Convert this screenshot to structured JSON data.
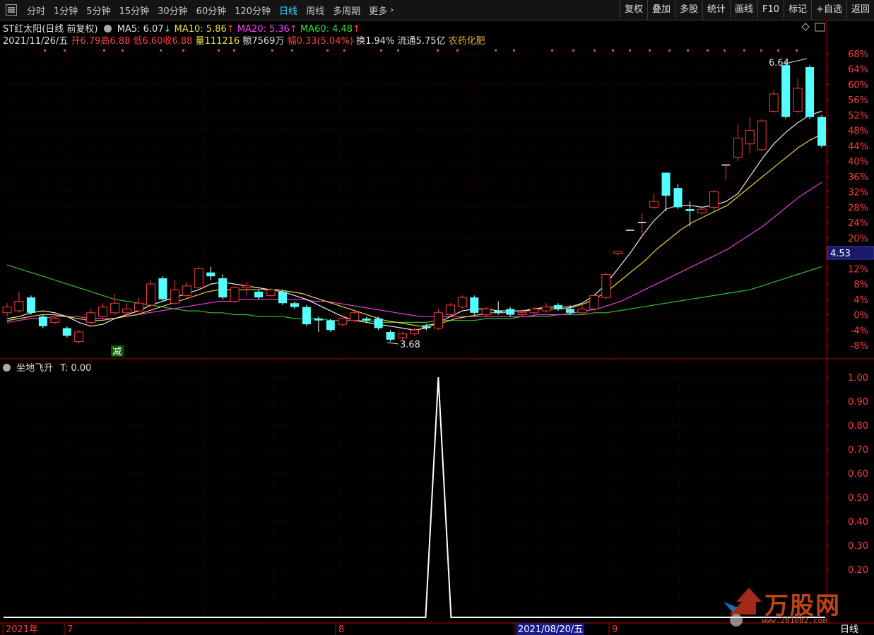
{
  "toolbar": {
    "tabs": [
      "分时",
      "1分钟",
      "5分钟",
      "15分钟",
      "30分钟",
      "60分钟",
      "120分钟",
      "日线",
      "周线",
      "多周期",
      "更多"
    ],
    "active_tab": "日线",
    "right_buttons": [
      "复权",
      "叠加",
      "多股",
      "统计",
      "画线",
      "F10",
      "标记",
      "+自选",
      "返回"
    ]
  },
  "stock": {
    "name": "ST红太阳(日线 前复权)",
    "ma5": "MA5: 6.07",
    "ma10": "MA10: 5.86",
    "ma20": "MA20: 5.36",
    "ma60": "MA60: 4.48",
    "date": "2021/11/26/五",
    "open": "开6.79",
    "high": "高6.88",
    "low": "低6.60",
    "close": "收6.88",
    "volume": "量111216",
    "amount": "额7569万",
    "change": "幅0.33(5.04%)",
    "turnover": "换1.94%",
    "float": "流通5.75亿",
    "sector": "农药化肥"
  },
  "price_axis": [
    "68%",
    "64%",
    "60%",
    "56%",
    "52%",
    "48%",
    "44%",
    "40%",
    "36%",
    "32%",
    "28%",
    "24%",
    "20%",
    "16%",
    "12%",
    "8%",
    "4%",
    "0%",
    "-4%",
    "-8%"
  ],
  "current_price_tag": "4.53",
  "annotations": {
    "high_label": "6.64",
    "low_label": "3.68",
    "marker_label": "减"
  },
  "sub_panel": {
    "title": "坐地飞升",
    "value": "T: 0.00",
    "axis": [
      "1.00",
      "0.90",
      "0.80",
      "0.70",
      "0.60",
      "0.50",
      "0.40",
      "0.30",
      "0.20"
    ]
  },
  "time_axis": {
    "labels": [
      "2021年",
      "7",
      "8",
      "2021/08/20/五",
      "9"
    ],
    "bottom_right": "日线"
  },
  "watermark": {
    "brand": "万股网",
    "url": "www.201082.com"
  },
  "colors": {
    "up": "#ff3c3c",
    "down": "#54ffff",
    "ma5": "#e8e8e8",
    "ma10": "#e8d040",
    "ma20": "#e040e0",
    "ma60": "#30c030",
    "grid": "#5a0000"
  },
  "chart_data": {
    "type": "candlestick",
    "candles": [
      {
        "o": 0.5,
        "c": 2.0,
        "h": 3.0,
        "l": -0.5
      },
      {
        "o": 1.0,
        "c": 3.5,
        "h": 6.0,
        "l": 0.5
      },
      {
        "o": 4.5,
        "c": 0.5,
        "h": 5.0,
        "l": 0.0
      },
      {
        "o": -0.5,
        "c": -3.0,
        "h": 0.0,
        "l": -3.5
      },
      {
        "o": -2.0,
        "c": -1.0,
        "h": -0.5,
        "l": -2.5
      },
      {
        "o": -3.5,
        "c": -5.5,
        "h": -3.0,
        "l": -6.0
      },
      {
        "o": -7.0,
        "c": -4.5,
        "h": -4.0,
        "l": -7.5
      },
      {
        "o": -2.0,
        "c": 0.5,
        "h": 1.5,
        "l": -2.5
      },
      {
        "o": -0.5,
        "c": 2.0,
        "h": 3.0,
        "l": -1.0
      },
      {
        "o": 0.5,
        "c": 3.0,
        "h": 5.5,
        "l": 0.0
      },
      {
        "o": 0.5,
        "c": 1.5,
        "h": 3.0,
        "l": -0.5
      },
      {
        "o": 1.0,
        "c": 3.0,
        "h": 4.5,
        "l": 0.5
      },
      {
        "o": 2.5,
        "c": 8.0,
        "h": 9.0,
        "l": 2.0
      },
      {
        "o": 9.5,
        "c": 4.0,
        "h": 10.0,
        "l": 3.5
      },
      {
        "o": 3.0,
        "c": 6.5,
        "h": 9.0,
        "l": 2.5
      },
      {
        "o": 5.0,
        "c": 7.5,
        "h": 8.5,
        "l": 4.5
      },
      {
        "o": 7.0,
        "c": 12.0,
        "h": 12.5,
        "l": 6.5
      },
      {
        "o": 11.0,
        "c": 10.0,
        "h": 12.5,
        "l": 9.0
      },
      {
        "o": 9.5,
        "c": 4.5,
        "h": 10.5,
        "l": 4.0
      },
      {
        "o": 3.5,
        "c": 7.0,
        "h": 7.5,
        "l": 3.0
      },
      {
        "o": 7.0,
        "c": 7.5,
        "h": 8.5,
        "l": 5.0
      },
      {
        "o": 6.0,
        "c": 4.5,
        "h": 6.5,
        "l": 4.0
      },
      {
        "o": 5.0,
        "c": 6.5,
        "h": 7.0,
        "l": 4.5
      },
      {
        "o": 6.0,
        "c": 3.0,
        "h": 6.5,
        "l": 2.5
      },
      {
        "o": 3.0,
        "c": 2.0,
        "h": 3.5,
        "l": 1.5
      },
      {
        "o": 2.0,
        "c": -2.5,
        "h": 2.5,
        "l": -3.0
      },
      {
        "o": -1.0,
        "c": -1.5,
        "h": -0.5,
        "l": -4.5
      },
      {
        "o": -1.5,
        "c": -4.0,
        "h": -1.0,
        "l": -4.5
      },
      {
        "o": -2.5,
        "c": -1.0,
        "h": 0.0,
        "l": -3.0
      },
      {
        "o": -1.5,
        "c": 0.5,
        "h": 1.0,
        "l": -2.0
      },
      {
        "o": -1.0,
        "c": -1.5,
        "h": -0.5,
        "l": -2.0
      },
      {
        "o": -1.0,
        "c": -3.5,
        "h": -0.5,
        "l": -4.0
      },
      {
        "o": -4.5,
        "c": -6.5,
        "h": -4.0,
        "l": -7.0
      },
      {
        "o": -6.0,
        "c": -5.0,
        "h": -4.5,
        "l": -6.5
      },
      {
        "o": -5.0,
        "c": -4.0,
        "h": -3.5,
        "l": -5.5
      },
      {
        "o": -3.0,
        "c": -3.5,
        "h": -2.5,
        "l": -4.0
      },
      {
        "o": -3.5,
        "c": 0.5,
        "h": 1.5,
        "l": -4.0
      },
      {
        "o": 0.0,
        "c": 2.5,
        "h": 3.0,
        "l": -0.5
      },
      {
        "o": 2.0,
        "c": 4.5,
        "h": 5.0,
        "l": 1.5
      },
      {
        "o": 4.5,
        "c": 0.5,
        "h": 5.0,
        "l": 0.0
      },
      {
        "o": 0.0,
        "c": 1.5,
        "h": 2.0,
        "l": -0.5
      },
      {
        "o": 1.0,
        "c": 0.5,
        "h": 3.5,
        "l": 0.0
      },
      {
        "o": 1.5,
        "c": 0.0,
        "h": 2.0,
        "l": -0.5
      },
      {
        "o": 0.0,
        "c": 0.5,
        "h": 1.5,
        "l": -0.5
      },
      {
        "o": 0.5,
        "c": 1.5,
        "h": 2.0,
        "l": 0.0
      },
      {
        "o": 1.0,
        "c": 2.0,
        "h": 3.0,
        "l": 0.5
      },
      {
        "o": 2.5,
        "c": 1.5,
        "h": 3.0,
        "l": 1.0
      },
      {
        "o": 1.5,
        "c": 0.5,
        "h": 2.5,
        "l": 0.0
      },
      {
        "o": 0.5,
        "c": 1.5,
        "h": 2.5,
        "l": 0.0
      },
      {
        "o": 1.5,
        "c": 5.0,
        "h": 5.5,
        "l": 1.0
      },
      {
        "o": 4.5,
        "c": 10.5,
        "h": 11.0,
        "l": 4.0
      },
      {
        "o": 16.0,
        "c": 16.5,
        "h": 16.5,
        "l": 15.5
      },
      {
        "o": 22.0,
        "c": 22.0,
        "h": 22.0,
        "l": 22.0
      },
      {
        "o": 24.0,
        "c": 24.0,
        "h": 26.5,
        "l": 21.0
      },
      {
        "o": 28.0,
        "c": 29.5,
        "h": 31.5,
        "l": 27.5
      },
      {
        "o": 37.0,
        "c": 31.0,
        "h": 37.0,
        "l": 27.0
      },
      {
        "o": 33.0,
        "c": 28.0,
        "h": 34.0,
        "l": 27.5
      },
      {
        "o": 27.5,
        "c": 27.0,
        "h": 29.5,
        "l": 23.0
      },
      {
        "o": 26.5,
        "c": 27.5,
        "h": 28.0,
        "l": 26.0
      },
      {
        "o": 28.0,
        "c": 32.0,
        "h": 32.5,
        "l": 27.0
      },
      {
        "o": 39.0,
        "c": 39.0,
        "h": 39.0,
        "l": 35.0
      },
      {
        "o": 41.0,
        "c": 46.0,
        "h": 49.5,
        "l": 40.0
      },
      {
        "o": 44.5,
        "c": 48.0,
        "h": 51.5,
        "l": 42.0
      },
      {
        "o": 43.0,
        "c": 50.5,
        "h": 51.0,
        "l": 42.5
      },
      {
        "o": 53.0,
        "c": 57.5,
        "h": 58.5,
        "l": 52.5
      },
      {
        "o": 65.0,
        "c": 51.5,
        "h": 66.0,
        "l": 51.0
      },
      {
        "o": 53.0,
        "c": 59.0,
        "h": 61.5,
        "l": 52.5
      },
      {
        "o": 64.5,
        "c": 51.5,
        "h": 65.0,
        "l": 51.0
      },
      {
        "o": 51.5,
        "c": 44.0,
        "h": 52.0,
        "l": 43.5
      }
    ],
    "ma5": [
      -1.0,
      -0.5,
      0.5,
      1.0,
      0.5,
      -0.5,
      -2.0,
      -3.0,
      -2.5,
      -1.0,
      0.0,
      1.0,
      2.5,
      3.5,
      4.5,
      5.5,
      6.5,
      8.0,
      8.5,
      8.0,
      7.5,
      7.0,
      6.5,
      6.0,
      5.0,
      4.0,
      2.5,
      1.0,
      -0.5,
      -1.5,
      -2.0,
      -2.5,
      -3.0,
      -3.5,
      -4.0,
      -3.5,
      -2.0,
      -0.5,
      1.0,
      1.5,
      1.5,
      1.0,
      1.0,
      1.0,
      1.5,
      2.0,
      2.0,
      2.0,
      3.0,
      5.0,
      8.0,
      12.0,
      16.0,
      20.5,
      24.5,
      27.5,
      28.5,
      28.5,
      28.0,
      28.5,
      29.5,
      31.5,
      36.0,
      40.5,
      44.5,
      47.5,
      50.0,
      52.0,
      53.0
    ],
    "ma10": [
      -1.5,
      -1.0,
      -0.5,
      0.0,
      0.0,
      -0.5,
      -1.0,
      -1.5,
      -1.5,
      -1.0,
      -0.5,
      0.0,
      1.0,
      2.0,
      3.0,
      4.0,
      5.0,
      6.0,
      6.5,
      6.5,
      6.5,
      6.5,
      6.5,
      6.5,
      6.0,
      5.5,
      4.5,
      3.5,
      2.5,
      1.5,
      0.5,
      -0.5,
      -1.5,
      -2.0,
      -2.5,
      -3.0,
      -2.5,
      -2.0,
      -1.0,
      -0.5,
      0.0,
      0.5,
      0.5,
      1.0,
      1.0,
      1.5,
      1.5,
      1.5,
      2.0,
      3.0,
      4.5,
      6.5,
      9.0,
      11.5,
      14.0,
      17.0,
      19.5,
      22.0,
      24.0,
      25.5,
      27.0,
      28.5,
      31.0,
      33.5,
      36.0,
      38.5,
      41.0,
      43.5,
      45.5,
      47.0
    ],
    "ma20": [
      -2.0,
      -1.5,
      -1.0,
      -1.0,
      -0.5,
      -0.5,
      -0.5,
      -1.0,
      -1.0,
      -1.0,
      -0.5,
      0.0,
      0.5,
      1.0,
      1.5,
      2.0,
      2.5,
      3.0,
      3.5,
      3.5,
      4.0,
      4.0,
      4.0,
      4.0,
      4.0,
      4.0,
      3.5,
      3.5,
      3.0,
      2.5,
      2.0,
      1.5,
      1.0,
      0.5,
      0.0,
      -0.5,
      -0.5,
      -0.5,
      -0.5,
      -0.5,
      -0.5,
      -0.5,
      -0.5,
      -0.5,
      -0.5,
      0.0,
      0.0,
      0.0,
      0.5,
      1.0,
      1.5,
      2.5,
      3.5,
      5.0,
      6.5,
      8.0,
      9.5,
      11.0,
      12.5,
      14.0,
      15.5,
      17.0,
      19.0,
      21.0,
      23.0,
      25.5,
      28.0,
      30.5,
      32.5,
      34.5
    ],
    "ma60": [
      13.0,
      12.0,
      11.0,
      10.0,
      9.0,
      8.0,
      7.0,
      6.0,
      5.0,
      4.0,
      3.5,
      3.0,
      2.5,
      2.0,
      1.5,
      1.0,
      1.0,
      0.5,
      0.5,
      0.0,
      0.0,
      -0.5,
      -0.5,
      -0.5,
      -1.0,
      -1.0,
      -1.0,
      -1.5,
      -1.5,
      -1.5,
      -1.5,
      -2.0,
      -2.0,
      -2.0,
      -2.0,
      -2.0,
      -1.5,
      -1.5,
      -1.5,
      -1.5,
      -1.0,
      -1.0,
      -1.0,
      -0.5,
      -0.5,
      -0.5,
      0.0,
      0.0,
      0.0,
      0.5,
      0.5,
      1.0,
      1.5,
      2.0,
      2.5,
      3.0,
      3.5,
      4.0,
      4.5,
      5.0,
      5.5,
      6.0,
      6.5,
      7.5,
      8.5,
      9.5,
      10.5,
      11.5,
      12.5
    ],
    "signal": {
      "peak_index": 36,
      "peak_value": 1.0,
      "baseline": 0.0
    }
  }
}
